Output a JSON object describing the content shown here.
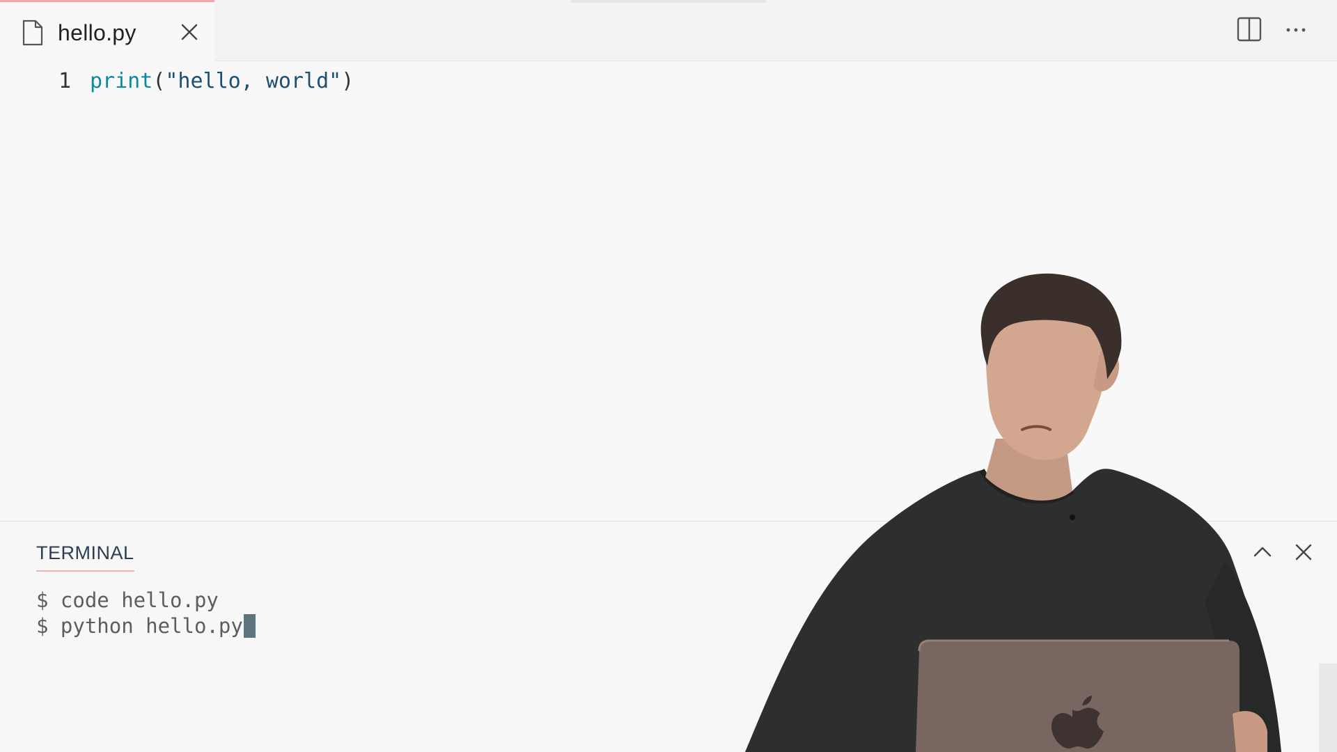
{
  "editor": {
    "tab": {
      "filename": "hello.py",
      "icon": "file-icon",
      "close_icon": "close-icon"
    },
    "actions": [
      {
        "name": "split-editor",
        "icon": "split-editor-icon"
      },
      {
        "name": "more-actions",
        "icon": "ellipsis-icon"
      }
    ],
    "lines": [
      {
        "number": "1",
        "tokens": [
          {
            "text": "print",
            "kind": "function"
          },
          {
            "text": "(",
            "kind": "punctuation"
          },
          {
            "text": "\"hello, world\"",
            "kind": "string"
          },
          {
            "text": ")",
            "kind": "punctuation"
          }
        ]
      }
    ]
  },
  "terminal": {
    "title": "TERMINAL",
    "lines": [
      {
        "text": "$ code hello.py"
      },
      {
        "text": "$ python hello.py"
      }
    ],
    "maximize_icon": "chevron-up-icon",
    "close_icon": "close-icon"
  },
  "colors": {
    "accent_tab": "#f2a7a7",
    "keyword": "#0b8a9f",
    "string": "#1d4f73",
    "terminal_text": "#5d5d5d",
    "cursor": "#5f7680",
    "background": "#f8f8f8"
  }
}
